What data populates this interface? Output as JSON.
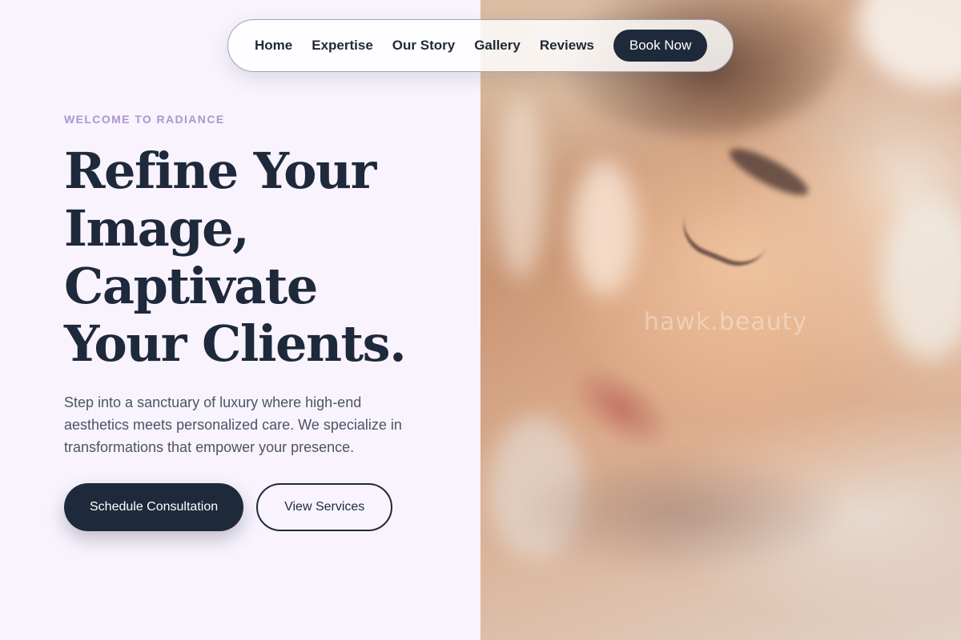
{
  "nav": {
    "links": [
      "Home",
      "Expertise",
      "Our Story",
      "Gallery",
      "Reviews"
    ],
    "cta_label": "Book Now"
  },
  "hero": {
    "eyebrow": "WELCOME TO RADIANCE",
    "headline_lines": [
      "Refine Your",
      "Image,",
      "Captivate",
      "Your Clients."
    ],
    "lead": "Step into a sanctuary of luxury where high-end aesthetics meets personalized care. We specialize in transformations that empower your presence.",
    "primary_cta": "Schedule Consultation",
    "secondary_cta": "View Services",
    "image_watermark": "hawk.beauty"
  },
  "colors": {
    "background": "#f8f3fd",
    "primary": "#1e293b",
    "accent_lavender": "#ab97cc",
    "body_text": "#4b5563"
  }
}
